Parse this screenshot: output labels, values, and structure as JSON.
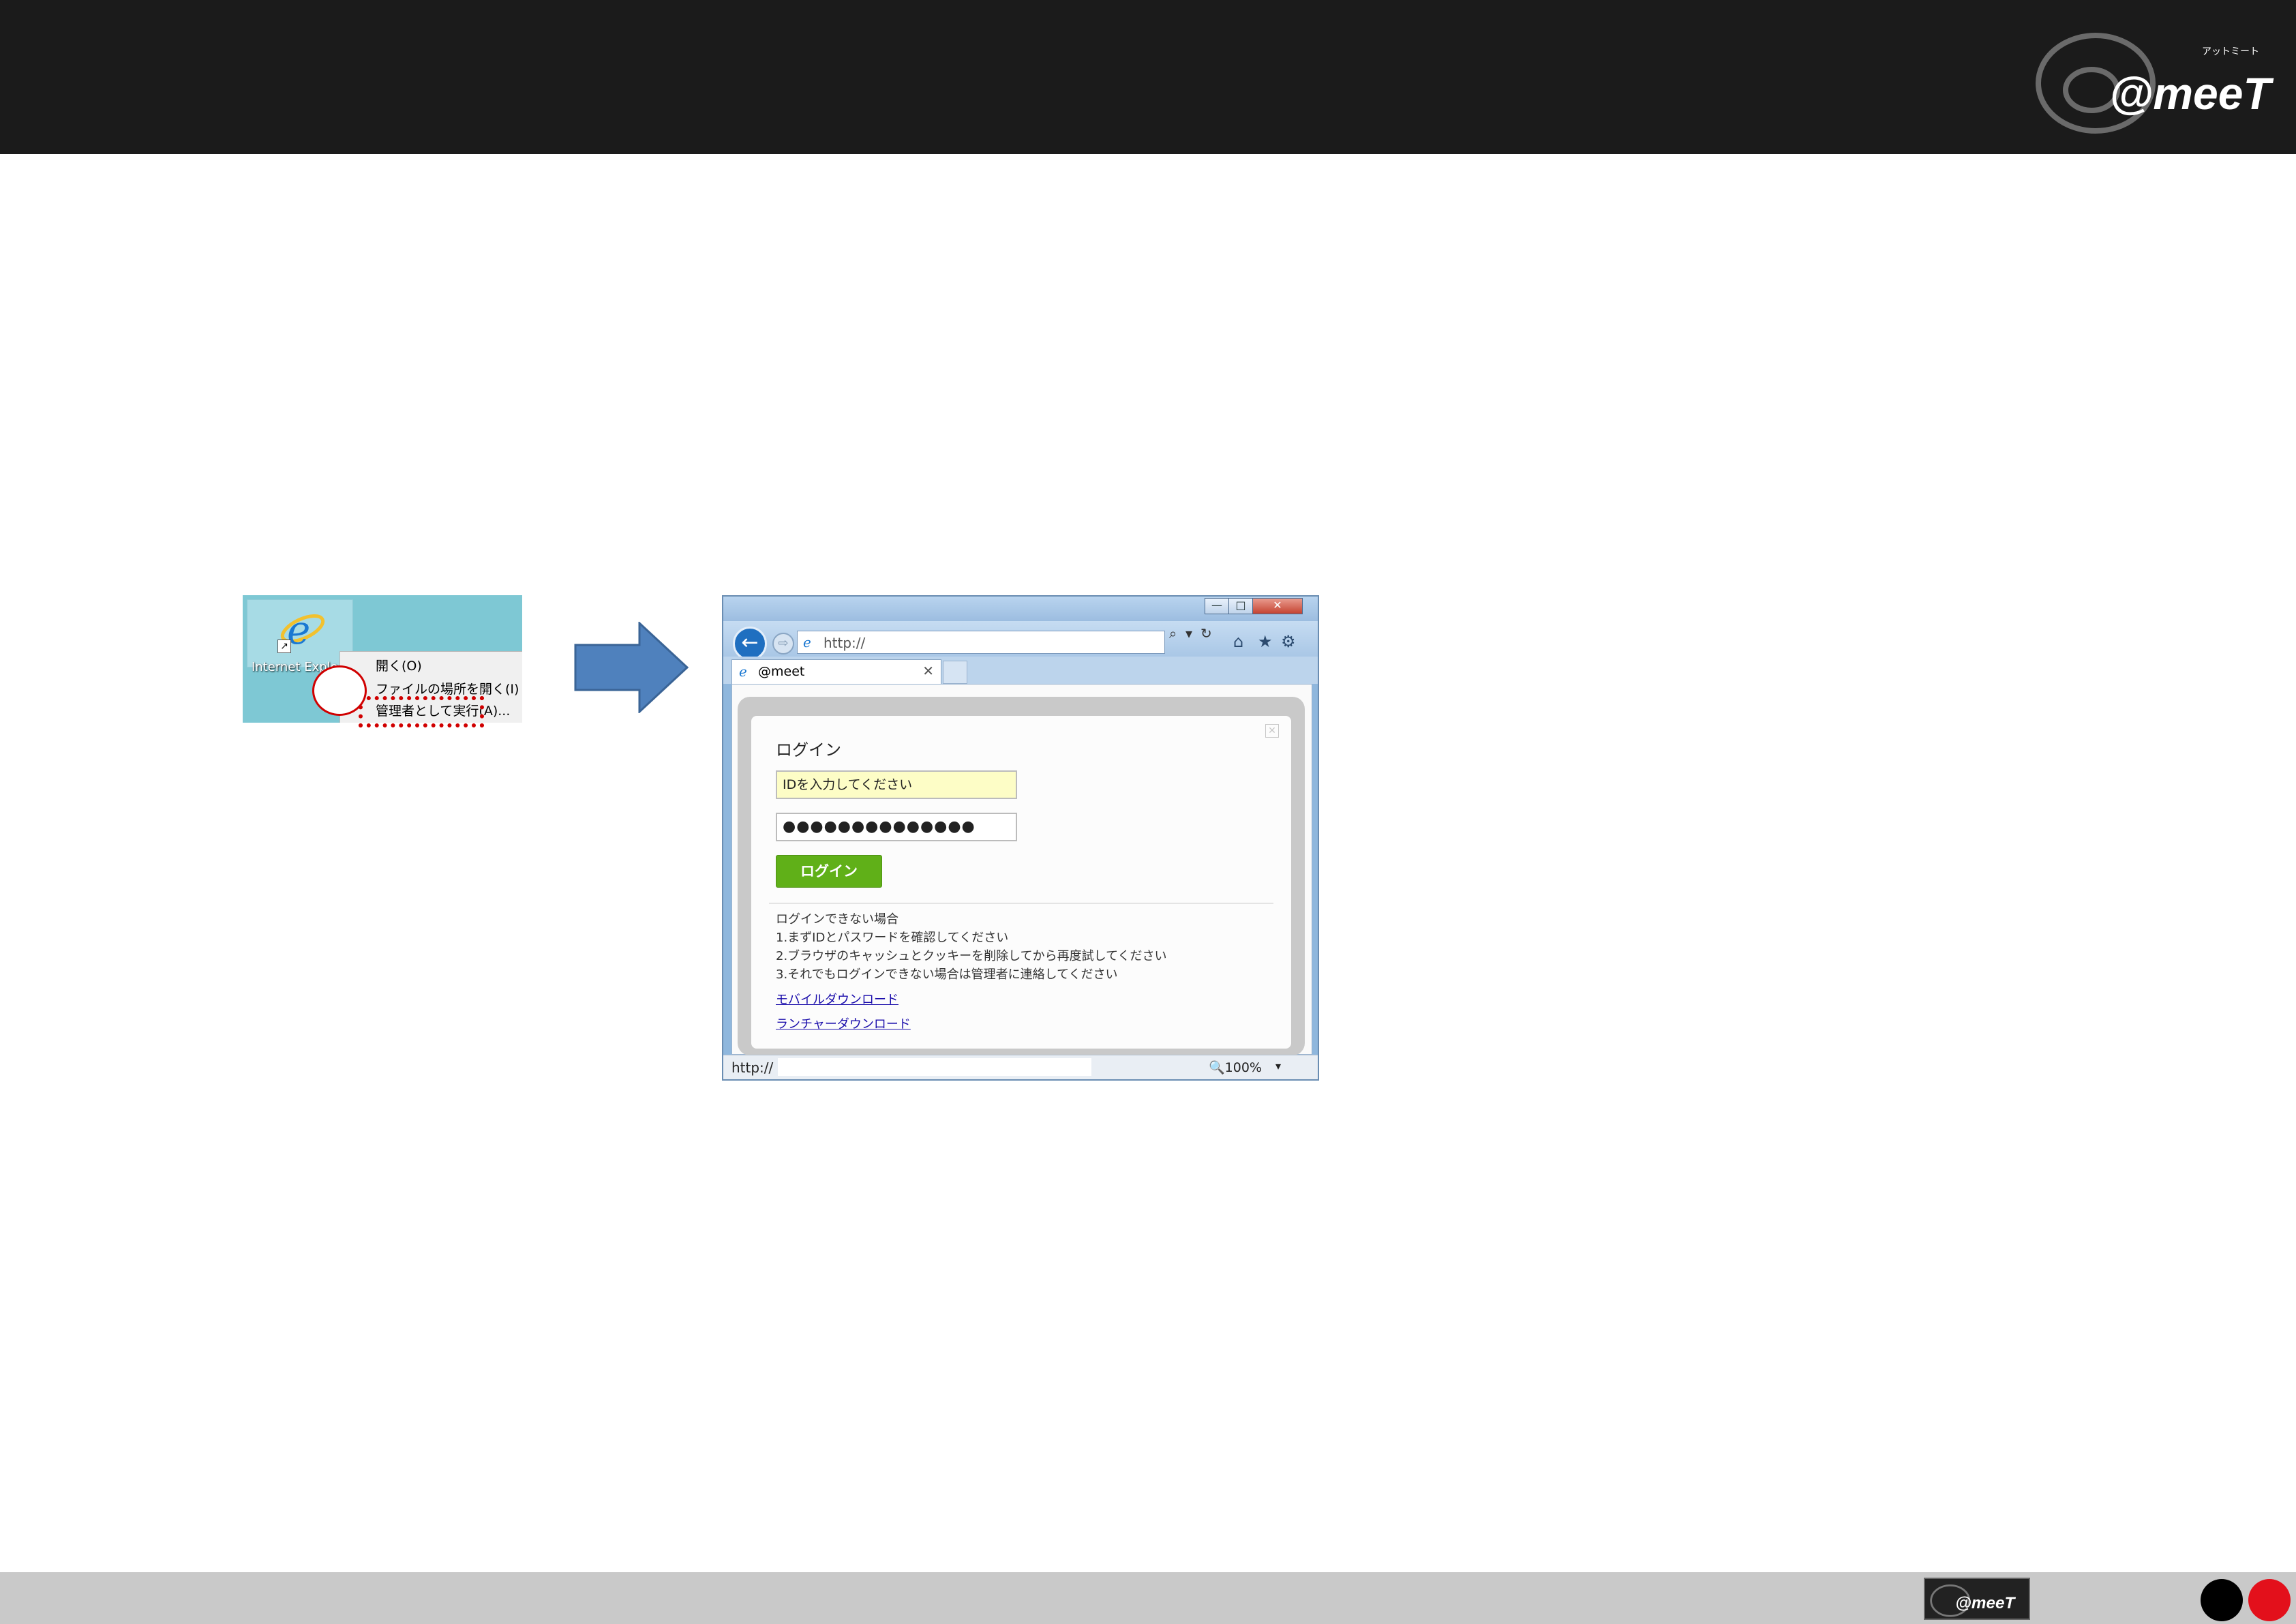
{
  "header": {
    "logo_text": "@meeT",
    "logo_kana": "アットミート"
  },
  "desktop": {
    "ie_label": "Internet Explo",
    "shortcut_glyph": "↗",
    "context_menu": [
      "開く(O)",
      "ファイルの場所を開く(I)",
      "管理者として実行(A)..."
    ]
  },
  "browser": {
    "window_buttons": [
      "—",
      "□",
      "✕"
    ],
    "back_glyph": "←",
    "forward_glyph": "⇨",
    "address": "http://",
    "addr_controls": [
      "⌕",
      "▾",
      "↻"
    ],
    "nav_icons": [
      "⌂",
      "★",
      "⚙"
    ],
    "tab_title": "@meet",
    "tab_close": "✕",
    "dialog_close": "✕",
    "login": {
      "title": "ログイン",
      "id_placeholder": "IDを入力してください",
      "password_mask": "●●●●●●●●●●●●●●",
      "button": "ログイン",
      "help_lines": [
        "ログインできない場合",
        "1.まずIDとパスワードを確認してください",
        "2.ブラウザのキャッシュとクッキーを削除してから再度試してください",
        "3.それでもログインできない場合は管理者に連絡してください"
      ],
      "links": [
        "モバイルダウンロード",
        "ランチャーダウンロード"
      ]
    },
    "status_url": "http://",
    "zoom": "🔍100%",
    "zoom_dropdown": "▾"
  },
  "colors": {
    "header_bg": "#1b1b1b",
    "footer_bg": "#c9c9c9",
    "accent_red": "#e3101b",
    "login_green": "#60b018"
  }
}
